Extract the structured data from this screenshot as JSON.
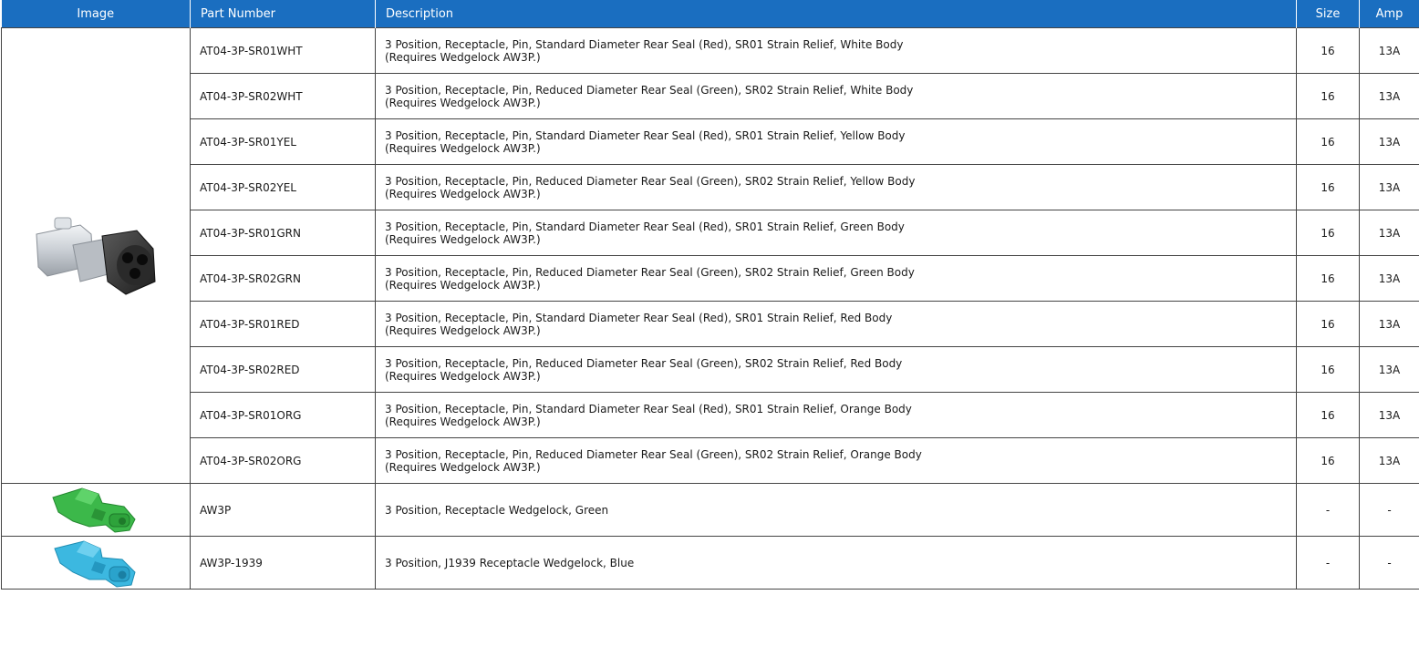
{
  "headers": {
    "image": "Image",
    "part_number": "Part Number",
    "description": "Description",
    "size": "Size",
    "amp": "Amp"
  },
  "rows": [
    {
      "part": "AT04-3P-SR01WHT",
      "desc1": "3 Position, Receptacle, Pin, Standard Diameter Rear Seal (Red), SR01 Strain Relief, White Body",
      "desc2": "(Requires Wedgelock AW3P.)",
      "size": "16",
      "amp": "13A"
    },
    {
      "part": "AT04-3P-SR02WHT",
      "desc1": "3 Position, Receptacle, Pin, Reduced Diameter Rear Seal (Green), SR02 Strain Relief, White Body",
      "desc2": "(Requires Wedgelock AW3P.)",
      "size": "16",
      "amp": "13A"
    },
    {
      "part": "AT04-3P-SR01YEL",
      "desc1": "3 Position, Receptacle, Pin, Standard Diameter Rear Seal (Red), SR01 Strain Relief, Yellow Body",
      "desc2": "(Requires Wedgelock AW3P.)",
      "size": "16",
      "amp": "13A"
    },
    {
      "part": "AT04-3P-SR02YEL",
      "desc1": "3 Position, Receptacle, Pin, Reduced Diameter Rear Seal (Green), SR02 Strain Relief, Yellow Body",
      "desc2": "(Requires Wedgelock AW3P.)",
      "size": "16",
      "amp": "13A"
    },
    {
      "part": "AT04-3P-SR01GRN",
      "desc1": "3 Position, Receptacle, Pin, Standard Diameter Rear Seal (Red), SR01 Strain Relief, Green Body",
      "desc2": "(Requires Wedgelock AW3P.)",
      "size": "16",
      "amp": "13A"
    },
    {
      "part": "AT04-3P-SR02GRN",
      "desc1": "3 Position, Receptacle, Pin, Reduced Diameter Rear Seal (Green), SR02 Strain Relief, Green Body",
      "desc2": "(Requires Wedgelock AW3P.)",
      "size": "16",
      "amp": "13A"
    },
    {
      "part": "AT04-3P-SR01RED",
      "desc1": "3 Position, Receptacle, Pin, Standard Diameter Rear Seal (Red), SR01 Strain Relief, Red Body",
      "desc2": "(Requires Wedgelock AW3P.)",
      "size": "16",
      "amp": "13A"
    },
    {
      "part": "AT04-3P-SR02RED",
      "desc1": "3 Position, Receptacle, Pin, Reduced Diameter Rear Seal (Green), SR02 Strain Relief, Red Body",
      "desc2": "(Requires Wedgelock AW3P.)",
      "size": "16",
      "amp": "13A"
    },
    {
      "part": "AT04-3P-SR01ORG",
      "desc1": "3 Position, Receptacle, Pin, Standard Diameter Rear Seal (Red), SR01 Strain Relief, Orange Body",
      "desc2": "(Requires Wedgelock AW3P.)",
      "size": "16",
      "amp": "13A"
    },
    {
      "part": "AT04-3P-SR02ORG",
      "desc1": "3 Position, Receptacle, Pin, Reduced Diameter Rear Seal (Green), SR02 Strain Relief, Orange Body",
      "desc2": "(Requires Wedgelock AW3P.)",
      "size": "16",
      "amp": "13A"
    }
  ],
  "wedgelocks": [
    {
      "part": "AW3P",
      "desc": "3 Position, Receptacle Wedgelock, Green",
      "size": "-",
      "amp": "-",
      "icon": "green-wedgelock-icon"
    },
    {
      "part": "AW3P-1939",
      "desc": "3 Position, J1939 Receptacle Wedgelock, Blue",
      "size": "-",
      "amp": "-",
      "icon": "blue-wedgelock-icon"
    }
  ],
  "colors": {
    "header_bg": "#1a6ec0",
    "header_text": "#ffffff",
    "border": "#444444",
    "green_wedgelock": "#3cb84a",
    "blue_wedgelock": "#3cb8e0"
  },
  "icons": {
    "connector": "grey-receptacle-connector-icon"
  }
}
